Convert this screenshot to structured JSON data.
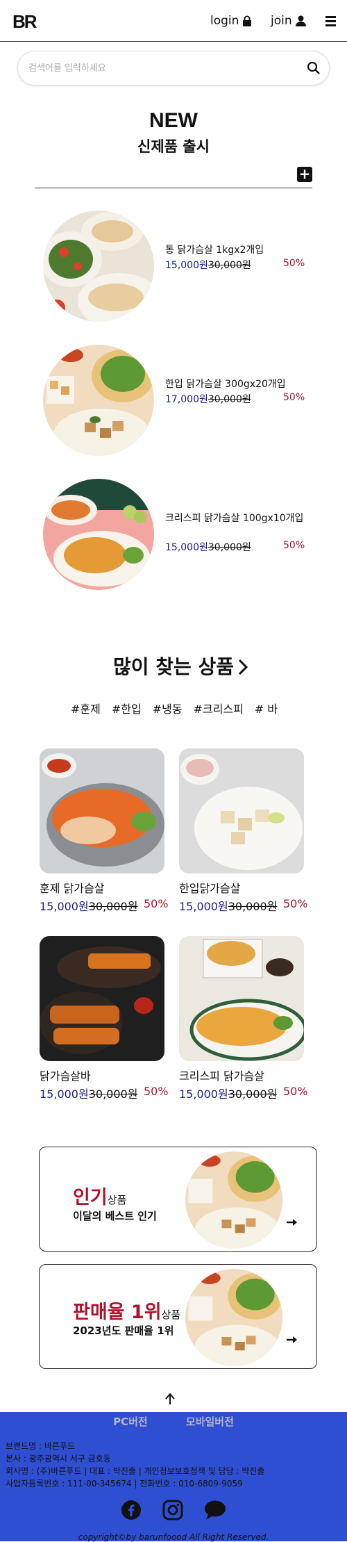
{
  "header": {
    "logo": "BR",
    "login_label": "login",
    "join_label": "join"
  },
  "search": {
    "placeholder": "검색어를 입력하세요"
  },
  "new_section": {
    "title": "NEW",
    "subtitle": "신제품 출시",
    "items": [
      {
        "name": "통 닭가슴살 1kgx2개입",
        "price": "15,000원",
        "old_price": "30,000원",
        "discount": "50%"
      },
      {
        "name": "한입 닭가슴살 300gx20개입",
        "price": "17,000원",
        "old_price": "30,000원",
        "discount": "50%"
      },
      {
        "name": "크리스피 닭가슴살 100gx10개입",
        "price": "15,000원",
        "old_price": "30,000원",
        "discount": "50%"
      }
    ]
  },
  "popular": {
    "title": "많이 찾는 상품",
    "tags": [
      "#훈제",
      "#한입",
      "#냉동",
      "#크리스피",
      "# 바"
    ],
    "items": [
      {
        "name": "훈제 닭가슴살",
        "price": "15,000원",
        "old_price": "30,000원",
        "discount": "50%"
      },
      {
        "name": "한입닭가슴살",
        "price": "15,000원",
        "old_price": "30,000원",
        "discount": "50%"
      },
      {
        "name": "닭가슴살바",
        "price": "15,000원",
        "old_price": "30,000원",
        "discount": "50%"
      },
      {
        "name": "크리스피 닭가슴살",
        "price": "15,000원",
        "old_price": "30,000원",
        "discount": "50%"
      }
    ]
  },
  "promos": [
    {
      "big": "인기",
      "small": "상품",
      "desc": "이달의 베스트 인기"
    },
    {
      "big": "판매율 1위",
      "small": "상품",
      "desc": "2023년도 판매율 1위"
    }
  ],
  "footer": {
    "tab_pc": "PC버전",
    "tab_mobile": "모바일버전",
    "line1": "브랜드명 : 바른푸드",
    "line2": "본사 : 광주광역시 서구 금호동",
    "line3": "회사명 : (주)바른푸드 | 대표 : 박진출 | 개인정보보호정책 및 담당 : 박진출",
    "line4": "사업자등록번호 : 111-00-345674 | 전화번호 : 010-6809-9059",
    "copyright": "copyright©by barunfoood All Right Reserved."
  },
  "colors": {
    "price": "#1a1f8c",
    "discount": "#b0122b",
    "footer_bg": "#2e4fd1"
  },
  "icons": [
    "lock-icon",
    "person-icon",
    "menu-icon",
    "search-icon",
    "plus-icon",
    "chevron-right-icon",
    "arrow-right-icon",
    "arrow-up-icon",
    "facebook-icon",
    "instagram-icon",
    "chat-icon"
  ]
}
